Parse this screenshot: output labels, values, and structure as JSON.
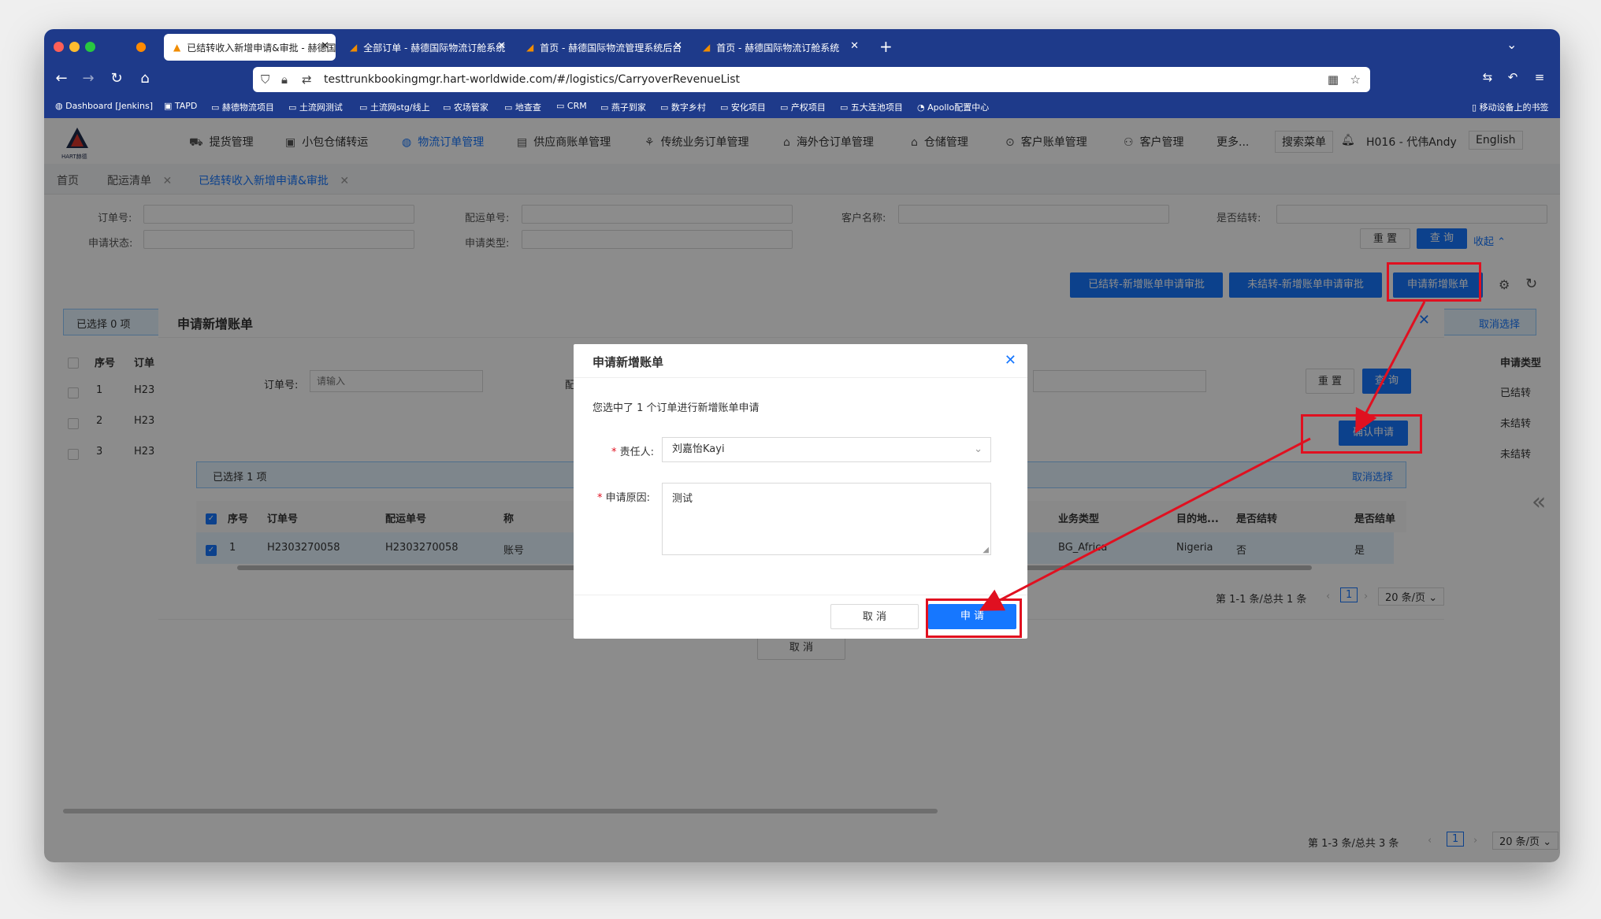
{
  "browser": {
    "tabs": [
      {
        "title": "已结转收入新增申请&审批 - 赫德国",
        "active": true
      },
      {
        "title": "全部订单 - 赫德国际物流订舱系统",
        "active": false
      },
      {
        "title": "首页 - 赫德国际物流管理系统后台",
        "active": false
      },
      {
        "title": "首页 - 赫德国际物流订舱系统",
        "active": false
      }
    ],
    "url": "testtrunkbookingmgr.hart-worldwide.com/#/logistics/CarryoverRevenueList",
    "bookmarks": [
      "Dashboard [Jenkins]",
      "TAPD",
      "赫德物流项目",
      "土流网测试",
      "土流网stg/线上",
      "农场管家",
      "地查查",
      "CRM",
      "燕子到家",
      "数字乡村",
      "安化项目",
      "产权项目",
      "五大连池项目",
      "Apollo配置中心"
    ],
    "mobile_bookmarks": "移动设备上的书签"
  },
  "app": {
    "logo_text": "HART赫德",
    "menu": [
      {
        "label": "提货管理",
        "icon": "truck-icon"
      },
      {
        "label": "小包仓储转运",
        "icon": "box-icon"
      },
      {
        "label": "物流订单管理",
        "icon": "globe-icon",
        "active": true
      },
      {
        "label": "供应商账单管理",
        "icon": "bill-icon"
      },
      {
        "label": "传统业务订单管理",
        "icon": "tree-icon"
      },
      {
        "label": "海外仓订单管理",
        "icon": "home-icon"
      },
      {
        "label": "仓储管理",
        "icon": "warehouse-icon"
      },
      {
        "label": "客户账单管理",
        "icon": "dollar-icon"
      },
      {
        "label": "客户管理",
        "icon": "users-icon"
      },
      {
        "label": "更多...",
        "icon": ""
      }
    ],
    "search_menu": "搜索菜单",
    "user": "H016 - 代伟Andy",
    "language": "English",
    "page_tabs": [
      "首页",
      "配运清单",
      "已结转收入新增申请&审批"
    ],
    "filters": {
      "order_no": "订单号:",
      "shipping_no": "配运单号:",
      "customer_name": "客户名称:",
      "is_carried": "是否结转:",
      "apply_status": "申请状态:",
      "apply_type": "申请类型:",
      "reset": "重 置",
      "query": "查 询",
      "collapse": "收起"
    },
    "actions": {
      "carried_audit": "已结转-新增账单申请审批",
      "uncarried_audit": "未结转-新增账单申请审批",
      "apply_new": "申请新增账单"
    },
    "main_table": {
      "selected": "已选择 0 项",
      "cancel_select": "取消选择",
      "col_index": "序号",
      "col_order": "订单",
      "col_apply_type": "申请类型",
      "rows": [
        {
          "index": "1",
          "order": "H23",
          "type": "已结转"
        },
        {
          "index": "2",
          "order": "H23",
          "type": "未结转"
        },
        {
          "index": "3",
          "order": "H23",
          "type": "未结转"
        }
      ],
      "pagination": "第 1-3 条/总共 3 条",
      "page": "1",
      "page_size": "20 条/页"
    }
  },
  "modal1": {
    "title": "申请新增账单",
    "order_label": "订单号:",
    "order_placeholder": "请输入",
    "shipping_label_partial": "配",
    "reset": "重 置",
    "query": "查 询",
    "confirm": "确认申请",
    "selected": "已选择 1 项",
    "cancel_select": "取消选择",
    "columns": [
      "序号",
      "订单号",
      "配运单号",
      "称",
      "业务类型",
      "目的地...",
      "是否结转",
      "是否结单"
    ],
    "row": {
      "index": "1",
      "order": "H2303270058",
      "shipping": "H2303270058",
      "name": "账号",
      "business": "BG_Africa",
      "dest": "Nigeria",
      "carried": "否",
      "closed": "是"
    },
    "pagination": "第 1-1 条/总共 1 条",
    "page": "1",
    "page_size": "20 条/页",
    "cancel": "取 消"
  },
  "dialog": {
    "title": "申请新增账单",
    "message": "您选中了 1 个订单进行新增账单申请",
    "owner_label": "责任人:",
    "owner_value": "刘嘉怡Kayi",
    "reason_label": "申请原因:",
    "reason_value": "测试",
    "cancel": "取 消",
    "submit": "申 请"
  },
  "colors": {
    "primary": "#1677ff",
    "annotation": "#e01020",
    "chrome": "#1e3a8a"
  }
}
